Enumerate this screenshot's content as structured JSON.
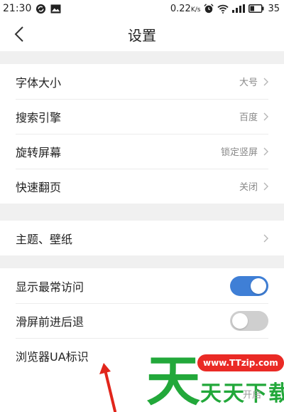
{
  "status_bar": {
    "time": "21:30",
    "network_speed": "0.22",
    "network_unit": "K/s",
    "battery": "35",
    "icons": [
      "sync-icon",
      "gallery-icon",
      "alarm-icon",
      "wifi-icon",
      "signal-icon",
      "battery-icon"
    ]
  },
  "nav": {
    "title": "设置",
    "back_icon": "chevron-left-icon"
  },
  "groups": [
    {
      "items": [
        {
          "label": "字体大小",
          "value": "大号",
          "control": "chevron"
        },
        {
          "label": "搜索引擎",
          "value": "百度",
          "control": "chevron"
        },
        {
          "label": "旋转屏幕",
          "value": "锁定竖屏",
          "control": "chevron"
        },
        {
          "label": "快速翻页",
          "value": "关闭",
          "control": "chevron"
        }
      ]
    },
    {
      "items": [
        {
          "label": "主题、壁纸",
          "value": "",
          "control": "chevron"
        }
      ]
    },
    {
      "items": [
        {
          "label": "显示最常访问",
          "control": "toggle",
          "enabled": true
        },
        {
          "label": "滑屏前进后退",
          "control": "toggle",
          "enabled": false
        },
        {
          "label": "浏览器UA标识",
          "value": "开启",
          "control": "none"
        }
      ]
    }
  ],
  "watermark": {
    "logo_char": "天",
    "url": "www.TTzip.com",
    "brand": "天天下载"
  },
  "colors": {
    "toggle_on": "#3f7fd6",
    "toggle_off": "#cfcfcf",
    "section_gap": "#f0f0f0",
    "watermark_green": "#22a83a",
    "watermark_red": "#ea2a25",
    "annotation_arrow": "#e1251b"
  }
}
